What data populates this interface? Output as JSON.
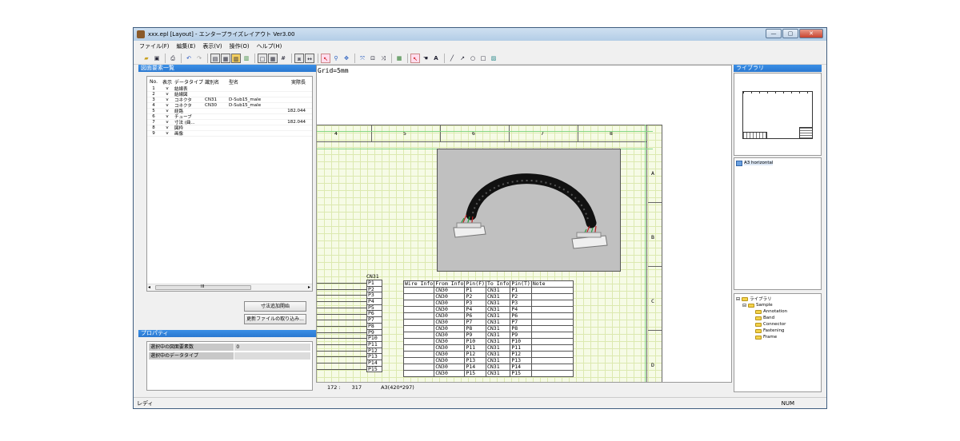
{
  "window": {
    "title": "xxx.epl [Layout] - エンタープライズレイアウト Ver3.00",
    "min": "—",
    "max": "▢",
    "close": "✕"
  },
  "menu": [
    "ファイル(F)",
    "編集(E)",
    "表示(V)",
    "操作(O)",
    "ヘルプ(H)"
  ],
  "left_panel": {
    "title": "図面要素一覧",
    "columns": [
      "No.",
      "表示",
      "データタイプ",
      "識別名",
      "型名",
      "実際長"
    ],
    "rows": [
      [
        "1",
        "v",
        "結線表",
        "",
        "",
        ""
      ],
      [
        "2",
        "v",
        "結線図",
        "",
        "",
        ""
      ],
      [
        "3",
        "v",
        "コネクタ",
        "CN31",
        "D-Sub15_male",
        ""
      ],
      [
        "4",
        "v",
        "コネクタ",
        "CN30",
        "D-Sub15_male",
        ""
      ],
      [
        "5",
        "v",
        "経路",
        "",
        "",
        "182.044"
      ],
      [
        "6",
        "v",
        "チューブ",
        "",
        "",
        ""
      ],
      [
        "7",
        "v",
        "寸法 (曲...",
        "",
        "",
        "182.044"
      ],
      [
        "8",
        "v",
        "図枠",
        "",
        "",
        ""
      ],
      [
        "9",
        "v",
        "画像",
        "",
        "",
        ""
      ]
    ],
    "scroll_glyph": "III",
    "btn_dim": "寸法追加開始",
    "btn_update": "更新ファイルの取り込み..."
  },
  "properties": {
    "title": "プロパティ",
    "rows": [
      [
        "選択中の図面要素数",
        "0"
      ],
      [
        "選択中のデータタイプ",
        ""
      ]
    ]
  },
  "canvas": {
    "grid_label": "Grid=5mm",
    "ruler_cols": [
      "4",
      "5",
      "6",
      "7",
      "8"
    ],
    "ruler_rows": [
      "A",
      "B",
      "C",
      "D"
    ],
    "cn_label": "CN31",
    "pins": [
      "P1",
      "P2",
      "P3",
      "P4",
      "P5",
      "P6",
      "P7",
      "P8",
      "P9",
      "P10",
      "P11",
      "P12",
      "P13",
      "P14",
      "P15"
    ],
    "wire_table": {
      "headers": [
        "Wire Info",
        "From Info",
        "Pin(F)",
        "To Info",
        "Pin(T)",
        "Note"
      ],
      "rows": [
        [
          "",
          "CN30",
          "P1",
          "CN31",
          "P1",
          ""
        ],
        [
          "",
          "CN30",
          "P2",
          "CN31",
          "P2",
          ""
        ],
        [
          "",
          "CN30",
          "P3",
          "CN31",
          "P3",
          ""
        ],
        [
          "",
          "CN30",
          "P4",
          "CN31",
          "P4",
          ""
        ],
        [
          "",
          "CN30",
          "P6",
          "CN31",
          "P6",
          ""
        ],
        [
          "",
          "CN30",
          "P7",
          "CN31",
          "P7",
          ""
        ],
        [
          "",
          "CN30",
          "P8",
          "CN31",
          "P8",
          ""
        ],
        [
          "",
          "CN30",
          "P9",
          "CN31",
          "P9",
          ""
        ],
        [
          "",
          "CN30",
          "P10",
          "CN31",
          "P10",
          ""
        ],
        [
          "",
          "CN30",
          "P11",
          "CN31",
          "P11",
          ""
        ],
        [
          "",
          "CN30",
          "P12",
          "CN31",
          "P12",
          ""
        ],
        [
          "",
          "CN30",
          "P13",
          "CN31",
          "P13",
          ""
        ],
        [
          "",
          "CN30",
          "P14",
          "CN31",
          "P14",
          ""
        ],
        [
          "",
          "CN30",
          "P15",
          "CN31",
          "P15",
          ""
        ]
      ]
    }
  },
  "canvas_status": {
    "x": "172 :",
    "y": "317",
    "paper": "A3(420*297)"
  },
  "library": {
    "title": "ライブラリ",
    "sheet_item": "A3 horizontal",
    "tree_root": "ライブラリ",
    "tree_sample": "Sample",
    "tree_children": [
      "Annotation",
      "Band",
      "Connector",
      "Fastening",
      "Frame"
    ]
  },
  "status": {
    "left": "レディ",
    "right": "NUM"
  }
}
